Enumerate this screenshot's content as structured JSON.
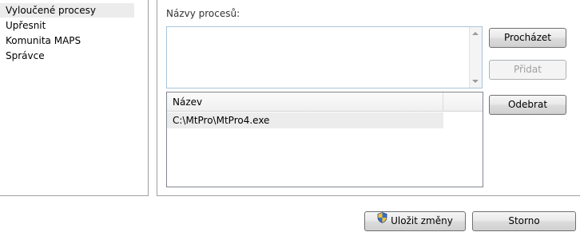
{
  "nav": {
    "items": [
      {
        "label": "Vyloučené procesy",
        "selected": true
      },
      {
        "label": "Upřesnit",
        "selected": false
      },
      {
        "label": "Komunita MAPS",
        "selected": false
      },
      {
        "label": "Správce",
        "selected": false
      }
    ]
  },
  "panel": {
    "process_names_label": "Názvy procesů:",
    "process_names_value": "",
    "buttons": {
      "browse": "Procházet",
      "add": "Přidat",
      "remove": "Odebrat"
    },
    "list": {
      "column_header": "Název",
      "rows": [
        "C:\\MtPro\\MtPro4.exe"
      ]
    }
  },
  "footer": {
    "save_label": "Uložit změny",
    "cancel_label": "Storno"
  },
  "icons": {
    "save": "uac-shield-icon",
    "scroll_up": "scroll-up-arrow-icon",
    "scroll_down": "scroll-down-arrow-icon"
  }
}
